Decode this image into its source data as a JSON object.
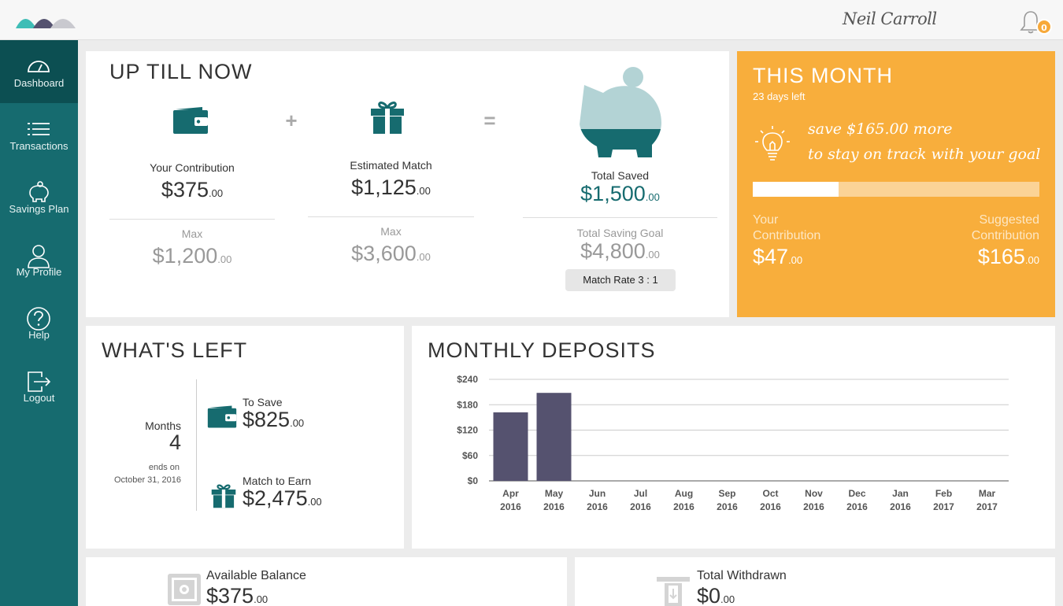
{
  "header": {
    "user_name": "Neil Carroll",
    "notification_count": "0"
  },
  "sidebar": {
    "items": [
      {
        "label": "Dashboard",
        "icon": "dashboard-icon"
      },
      {
        "label": "Transactions",
        "icon": "list-icon"
      },
      {
        "label": "Savings Plan",
        "icon": "piggy-bank-icon"
      },
      {
        "label": "My Profile",
        "icon": "user-icon"
      },
      {
        "label": "Help",
        "icon": "help-icon"
      },
      {
        "label": "Logout",
        "icon": "logout-icon"
      }
    ]
  },
  "up_till_now": {
    "title": "UP TILL NOW",
    "contribution": {
      "label": "Your Contribution",
      "value": "$375",
      "cents": ".00",
      "max_label": "Max",
      "max_value": "$1,200",
      "max_cents": ".00"
    },
    "match": {
      "label": "Estimated Match",
      "value": "$1,125",
      "cents": ".00",
      "max_label": "Max",
      "max_value": "$3,600",
      "max_cents": ".00"
    },
    "total": {
      "label": "Total Saved",
      "value": "$1,500",
      "cents": ".00",
      "goal_label": "Total Saving Goal",
      "goal_value": "$4,800",
      "goal_cents": ".00"
    },
    "match_rate": "Match Rate 3 : 1",
    "plus_sign": "+",
    "equals_sign": "="
  },
  "this_month": {
    "title": "THIS MONTH",
    "days_left": "23 days left",
    "message_line1": "save $165.00 more",
    "message_line2": "to stay on track with your goal",
    "progress_fraction": 0.3,
    "your_label_1": "Your",
    "your_label_2": "Contribution",
    "your_value": "$47",
    "your_cents": ".00",
    "suggested_label_1": "Suggested",
    "suggested_label_2": "Contribution",
    "suggested_value": "$165",
    "suggested_cents": ".00"
  },
  "whats_left": {
    "title": "WHAT'S LEFT",
    "months_label": "Months",
    "months_value": "4",
    "ends_label": "ends on",
    "ends_date": "October 31, 2016",
    "to_save_label": "To Save",
    "to_save_value": "$825",
    "to_save_cents": ".00",
    "match_label": "Match to Earn",
    "match_value": "$2,475",
    "match_cents": ".00"
  },
  "monthly_deposits": {
    "title": "MONTHLY DEPOSITS"
  },
  "chart_data": {
    "type": "bar",
    "categories": [
      "Apr 2016",
      "May 2016",
      "Jun 2016",
      "Jul 2016",
      "Aug 2016",
      "Sep 2016",
      "Oct 2016",
      "Nov 2016",
      "Dec 2016",
      "Jan 2016",
      "Feb 2017",
      "Mar 2017"
    ],
    "category_lines": [
      [
        "Apr",
        "2016"
      ],
      [
        "May",
        "2016"
      ],
      [
        "Jun",
        "2016"
      ],
      [
        "Jul",
        "2016"
      ],
      [
        "Aug",
        "2016"
      ],
      [
        "Sep",
        "2016"
      ],
      [
        "Oct",
        "2016"
      ],
      [
        "Nov",
        "2016"
      ],
      [
        "Dec",
        "2016"
      ],
      [
        "Jan",
        "2016"
      ],
      [
        "Feb",
        "2017"
      ],
      [
        "Mar",
        "2017"
      ]
    ],
    "values": [
      162,
      208,
      0,
      0,
      0,
      0,
      0,
      0,
      0,
      0,
      0,
      0
    ],
    "yticks": [
      0,
      60,
      120,
      180,
      240
    ],
    "ytick_labels": [
      "$0",
      "$60",
      "$120",
      "$180",
      "$240"
    ],
    "ylim": [
      0,
      240
    ],
    "grid": true,
    "bar_color": "#55526f"
  },
  "balances": {
    "available_label": "Available Balance",
    "available_value": "$375",
    "available_cents": ".00",
    "withdrawn_label": "Total Withdrawn",
    "withdrawn_value": "$0",
    "withdrawn_cents": ".00"
  }
}
